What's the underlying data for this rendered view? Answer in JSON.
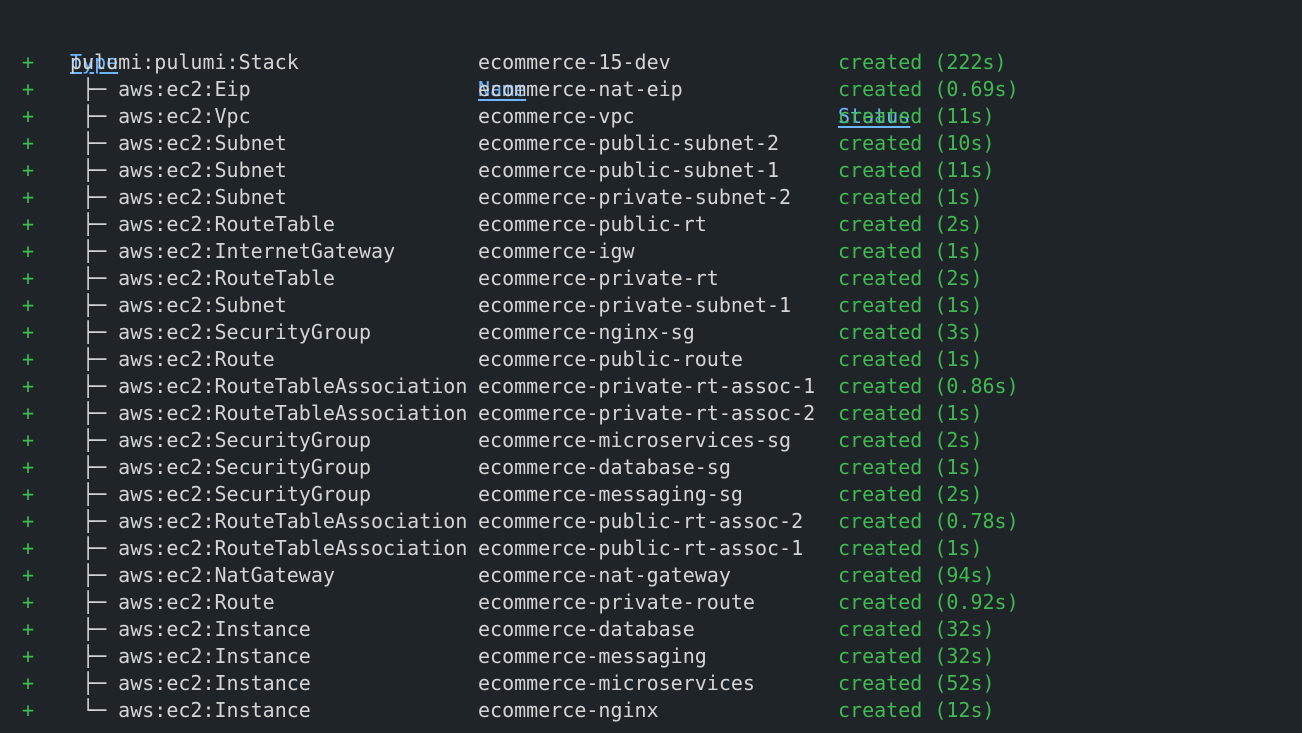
{
  "headers": {
    "type": "Type",
    "name": "Name",
    "status": "Status"
  },
  "rows": [
    {
      "op": "+",
      "tree": "",
      "type": "pulumi:pulumi:Stack",
      "name": "ecommerce-15-dev",
      "status": "created (222s)"
    },
    {
      "op": "+",
      "tree": "├─ ",
      "type": "aws:ec2:Eip",
      "name": "ecommerce-nat-eip",
      "status": "created (0.69s)"
    },
    {
      "op": "+",
      "tree": "├─ ",
      "type": "aws:ec2:Vpc",
      "name": "ecommerce-vpc",
      "status": "created (11s)"
    },
    {
      "op": "+",
      "tree": "├─ ",
      "type": "aws:ec2:Subnet",
      "name": "ecommerce-public-subnet-2",
      "status": "created (10s)"
    },
    {
      "op": "+",
      "tree": "├─ ",
      "type": "aws:ec2:Subnet",
      "name": "ecommerce-public-subnet-1",
      "status": "created (11s)"
    },
    {
      "op": "+",
      "tree": "├─ ",
      "type": "aws:ec2:Subnet",
      "name": "ecommerce-private-subnet-2",
      "status": "created (1s)"
    },
    {
      "op": "+",
      "tree": "├─ ",
      "type": "aws:ec2:RouteTable",
      "name": "ecommerce-public-rt",
      "status": "created (2s)"
    },
    {
      "op": "+",
      "tree": "├─ ",
      "type": "aws:ec2:InternetGateway",
      "name": "ecommerce-igw",
      "status": "created (1s)"
    },
    {
      "op": "+",
      "tree": "├─ ",
      "type": "aws:ec2:RouteTable",
      "name": "ecommerce-private-rt",
      "status": "created (2s)"
    },
    {
      "op": "+",
      "tree": "├─ ",
      "type": "aws:ec2:Subnet",
      "name": "ecommerce-private-subnet-1",
      "status": "created (1s)"
    },
    {
      "op": "+",
      "tree": "├─ ",
      "type": "aws:ec2:SecurityGroup",
      "name": "ecommerce-nginx-sg",
      "status": "created (3s)"
    },
    {
      "op": "+",
      "tree": "├─ ",
      "type": "aws:ec2:Route",
      "name": "ecommerce-public-route",
      "status": "created (1s)"
    },
    {
      "op": "+",
      "tree": "├─ ",
      "type": "aws:ec2:RouteTableAssociation",
      "name": "ecommerce-private-rt-assoc-1",
      "status": "created (0.86s)"
    },
    {
      "op": "+",
      "tree": "├─ ",
      "type": "aws:ec2:RouteTableAssociation",
      "name": "ecommerce-private-rt-assoc-2",
      "status": "created (1s)"
    },
    {
      "op": "+",
      "tree": "├─ ",
      "type": "aws:ec2:SecurityGroup",
      "name": "ecommerce-microservices-sg",
      "status": "created (2s)"
    },
    {
      "op": "+",
      "tree": "├─ ",
      "type": "aws:ec2:SecurityGroup",
      "name": "ecommerce-database-sg",
      "status": "created (1s)"
    },
    {
      "op": "+",
      "tree": "├─ ",
      "type": "aws:ec2:SecurityGroup",
      "name": "ecommerce-messaging-sg",
      "status": "created (2s)"
    },
    {
      "op": "+",
      "tree": "├─ ",
      "type": "aws:ec2:RouteTableAssociation",
      "name": "ecommerce-public-rt-assoc-2",
      "status": "created (0.78s)"
    },
    {
      "op": "+",
      "tree": "├─ ",
      "type": "aws:ec2:RouteTableAssociation",
      "name": "ecommerce-public-rt-assoc-1",
      "status": "created (1s)"
    },
    {
      "op": "+",
      "tree": "├─ ",
      "type": "aws:ec2:NatGateway",
      "name": "ecommerce-nat-gateway",
      "status": "created (94s)"
    },
    {
      "op": "+",
      "tree": "├─ ",
      "type": "aws:ec2:Route",
      "name": "ecommerce-private-route",
      "status": "created (0.92s)"
    },
    {
      "op": "+",
      "tree": "├─ ",
      "type": "aws:ec2:Instance",
      "name": "ecommerce-database",
      "status": "created (32s)"
    },
    {
      "op": "+",
      "tree": "├─ ",
      "type": "aws:ec2:Instance",
      "name": "ecommerce-messaging",
      "status": "created (32s)"
    },
    {
      "op": "+",
      "tree": "├─ ",
      "type": "aws:ec2:Instance",
      "name": "ecommerce-microservices",
      "status": "created (52s)"
    },
    {
      "op": "+",
      "tree": "└─ ",
      "type": "aws:ec2:Instance",
      "name": "ecommerce-nginx",
      "status": "created (12s)"
    }
  ],
  "colors": {
    "background": "#1f2428",
    "text": "#d4d4d4",
    "created": "#3fb950",
    "header_link": "#6cb6ff"
  }
}
